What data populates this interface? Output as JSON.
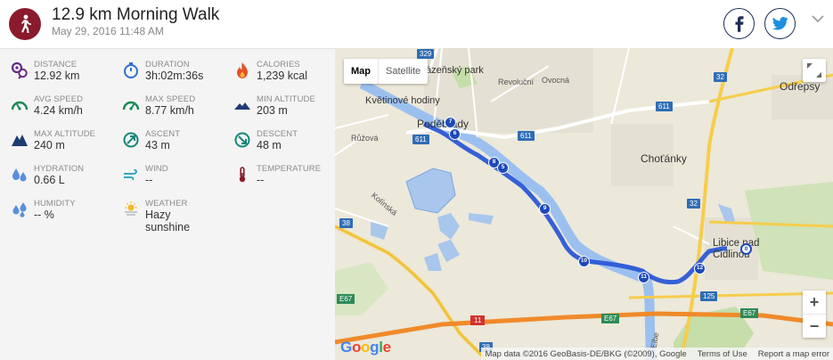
{
  "activity": {
    "title": "12.9 km Morning Walk",
    "date": "May 29, 2016 11:48 AM",
    "icon": "walking-person-icon",
    "icon_color": "#8a1b2c"
  },
  "social": {
    "facebook_icon": "facebook-icon",
    "twitter_icon": "twitter-icon",
    "expand_icon": "chevron-down-icon"
  },
  "stats": [
    {
      "label": "DISTANCE",
      "value": "12.92 km",
      "icon": "distance-pin-icon"
    },
    {
      "label": "DURATION",
      "value": "3h:02m:36s",
      "icon": "stopwatch-icon"
    },
    {
      "label": "CALORIES",
      "value": "1,239 kcal",
      "icon": "flame-icon"
    },
    {
      "label": "AVG SPEED",
      "value": "4.24 km/h",
      "icon": "speedometer-icon"
    },
    {
      "label": "MAX SPEED",
      "value": "8.77 km/h",
      "icon": "speedometer-max-icon"
    },
    {
      "label": "MIN ALTITUDE",
      "value": "203 m",
      "icon": "mountain-low-icon"
    },
    {
      "label": "MAX ALTITUDE",
      "value": "240 m",
      "icon": "mountain-high-icon"
    },
    {
      "label": "ASCENT",
      "value": "43 m",
      "icon": "ascent-icon"
    },
    {
      "label": "DESCENT",
      "value": "48 m",
      "icon": "descent-icon"
    },
    {
      "label": "HYDRATION",
      "value": "0.66 L",
      "icon": "water-drops-icon"
    },
    {
      "label": "WIND",
      "value": "--",
      "icon": "wind-icon"
    },
    {
      "label": "TEMPERATURE",
      "value": "--",
      "icon": "thermometer-icon"
    },
    {
      "label": "HUMIDITY",
      "value": "-- %",
      "icon": "humidity-drops-icon"
    },
    {
      "label": "WEATHER",
      "value": "Hazy sunshine",
      "icon": "hazy-sun-icon"
    }
  ],
  "map": {
    "type_map": "Map",
    "type_satellite": "Satellite",
    "zoom_in": "+",
    "zoom_out": "−",
    "google": "Google",
    "attribution": "Map data ©2016 GeoBasis-DE/BKG (©2009), Google",
    "terms": "Terms of Use",
    "report": "Report a map error",
    "places": {
      "park": "ázeňský park",
      "revolucni": "Revoluční",
      "ovocna": "Ovocná",
      "kvetinove": "Květinové hodiny",
      "podebrady": "Poděbrady",
      "ruzova": "Růžová",
      "chotanky": "Choťánky",
      "odrepsy": "Odřepsy",
      "kolinska": "Kolínská",
      "libice": "Libice nad Cidlinou",
      "elbe": "Elbe"
    },
    "roads": {
      "r329": "329",
      "r611a": "611",
      "r611b": "611",
      "r611c": "611",
      "r32a": "32",
      "r32b": "32",
      "r38a": "38",
      "r38b": "38",
      "r125": "125",
      "e67a": "E67",
      "e67b": "E67",
      "e67c": "E67",
      "d11": "11"
    },
    "markers": [
      "7",
      "6",
      "8",
      "5",
      "9",
      "10",
      "11",
      "12",
      "0"
    ]
  }
}
